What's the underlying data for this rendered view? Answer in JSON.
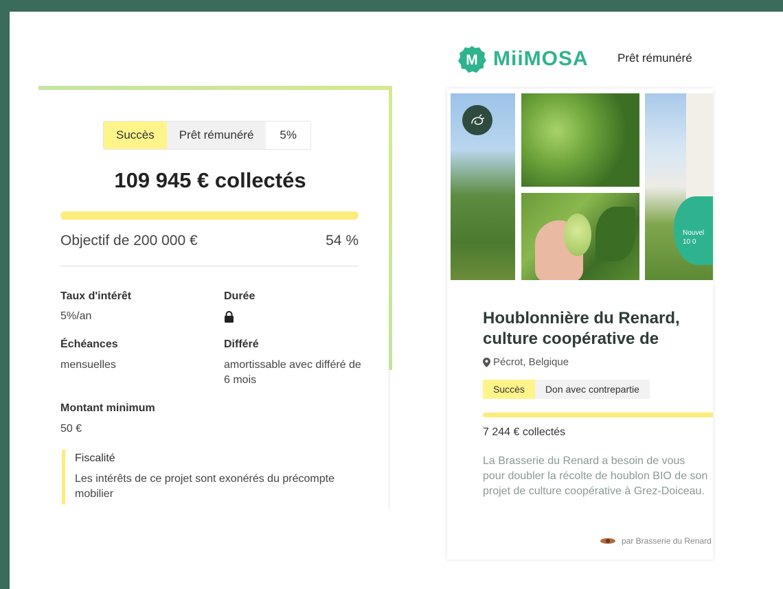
{
  "left_card": {
    "status_badge": "Succès",
    "type_badge": "Prêt rémunéré",
    "rate_badge": "5%",
    "collected": "109 945 € collectés",
    "progress_fraction": 1.0,
    "objective": "Objectif de 200 000 €",
    "percent": "54 %",
    "fields": {
      "rate_label": "Taux d'intérêt",
      "rate_value": "5%/an",
      "duration_label": "Durée",
      "schedule_label": "Échéances",
      "schedule_value": "mensuelles",
      "deferral_label": "Différé",
      "deferral_value": "amortissable avec différé de 6 mois",
      "minimum_label": "Montant minimum",
      "minimum_value": "50 €"
    },
    "fiscal": {
      "title": "Fiscalité",
      "text": "Les intérêts de ce projet sont exonérés du précompte mobilier"
    }
  },
  "header": {
    "logo_letter": "M",
    "brand": "MiiMOSA",
    "nav_label": "Prêt rémunéré"
  },
  "project_card": {
    "overlay_text_line1": "Nouvel",
    "overlay_text_line2": "10 0",
    "title": "Houblonnière du Renard, culture coopérative de",
    "location": "Pécrot, Belgique",
    "status_badge": "Succès",
    "type_badge": "Don avec contrepartie",
    "progress_fraction": 1.0,
    "collected": "7 244 € collectés",
    "description": "La Brasserie du Renard a besoin de vous pour doubler la récolte de houblon BIO de son projet de culture coopérative à Grez-Doiceau.",
    "author": "par Brasserie du Renard"
  },
  "colors": {
    "brand_green": "#2fb38e",
    "success_yellow": "#fff48a",
    "frame_green": "#3b6b5a"
  }
}
